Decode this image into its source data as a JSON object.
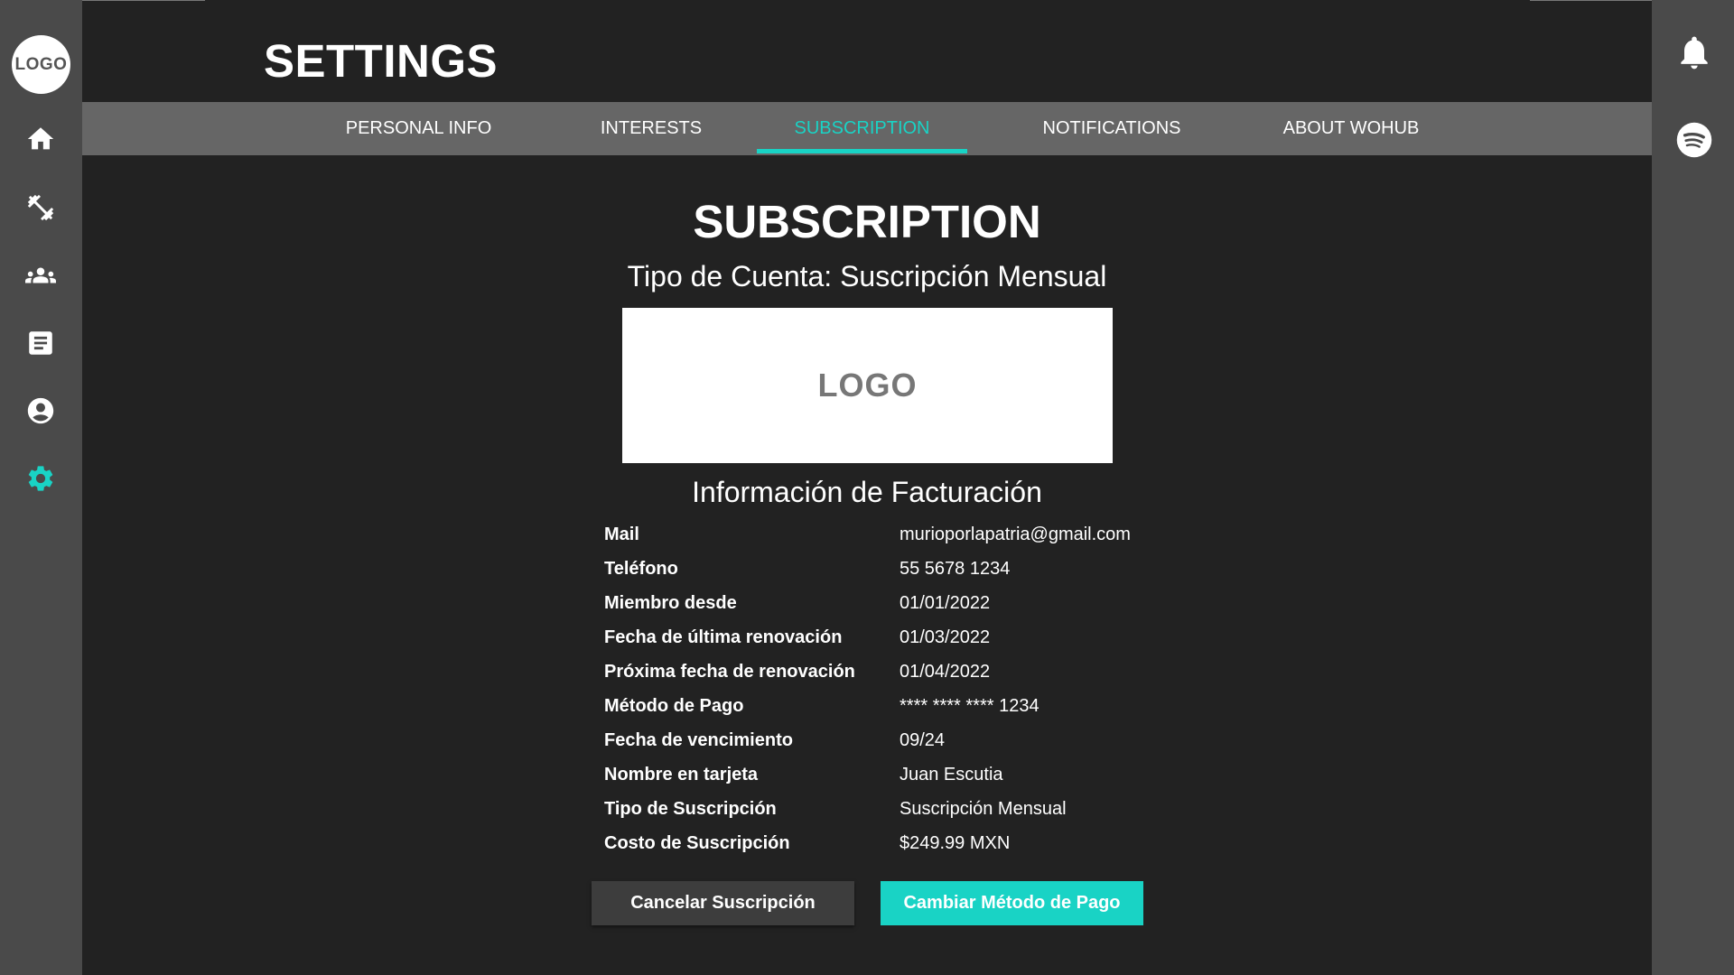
{
  "colors": {
    "accent": "#19d3c5",
    "sidebar": "#4a4a4a",
    "tabbar": "#666666",
    "background": "#222222"
  },
  "sidebar": {
    "logo": "LOGO",
    "items": [
      {
        "icon": "home-icon"
      },
      {
        "icon": "dumbbell-icon"
      },
      {
        "icon": "group-icon"
      },
      {
        "icon": "document-icon"
      },
      {
        "icon": "account-icon"
      },
      {
        "icon": "gear-icon",
        "active": true
      }
    ]
  },
  "right_sidebar": {
    "items": [
      {
        "icon": "bell-icon"
      },
      {
        "icon": "spotify-icon"
      }
    ]
  },
  "header": {
    "title": "SETTINGS"
  },
  "tabs": [
    {
      "label": "PERSONAL INFO"
    },
    {
      "label": "INTERESTS"
    },
    {
      "label": "SUBSCRIPTION",
      "active": true
    },
    {
      "label": "NOTIFICATIONS"
    },
    {
      "label": "ABOUT WOHUB"
    }
  ],
  "subscription": {
    "title": "SUBSCRIPTION",
    "account_type": "Tipo de Cuenta: Suscripción Mensual",
    "logo_placeholder": "LOGO",
    "billing_title": "Información de Facturación",
    "rows": [
      {
        "label": "Mail",
        "value": "murioporlapatria@gmail.com"
      },
      {
        "label": "Teléfono",
        "value": "55 5678 1234"
      },
      {
        "label": "Miembro desde",
        "value": "01/01/2022"
      },
      {
        "label": "Fecha de última renovación",
        "value": "01/03/2022"
      },
      {
        "label": "Próxima fecha de renovación",
        "value": "01/04/2022"
      },
      {
        "label": "Método de Pago",
        "value": "**** **** **** 1234"
      },
      {
        "label": "Fecha de vencimiento",
        "value": "09/24"
      },
      {
        "label": "Nombre en tarjeta",
        "value": "Juan Escutia"
      },
      {
        "label": "Tipo de Suscripción",
        "value": "Suscripción Mensual"
      },
      {
        "label": "Costo de Suscripción",
        "value": "$249.99 MXN"
      }
    ],
    "cancel_button": "Cancelar Suscripción",
    "change_payment_button": "Cambiar Método de Pago"
  }
}
